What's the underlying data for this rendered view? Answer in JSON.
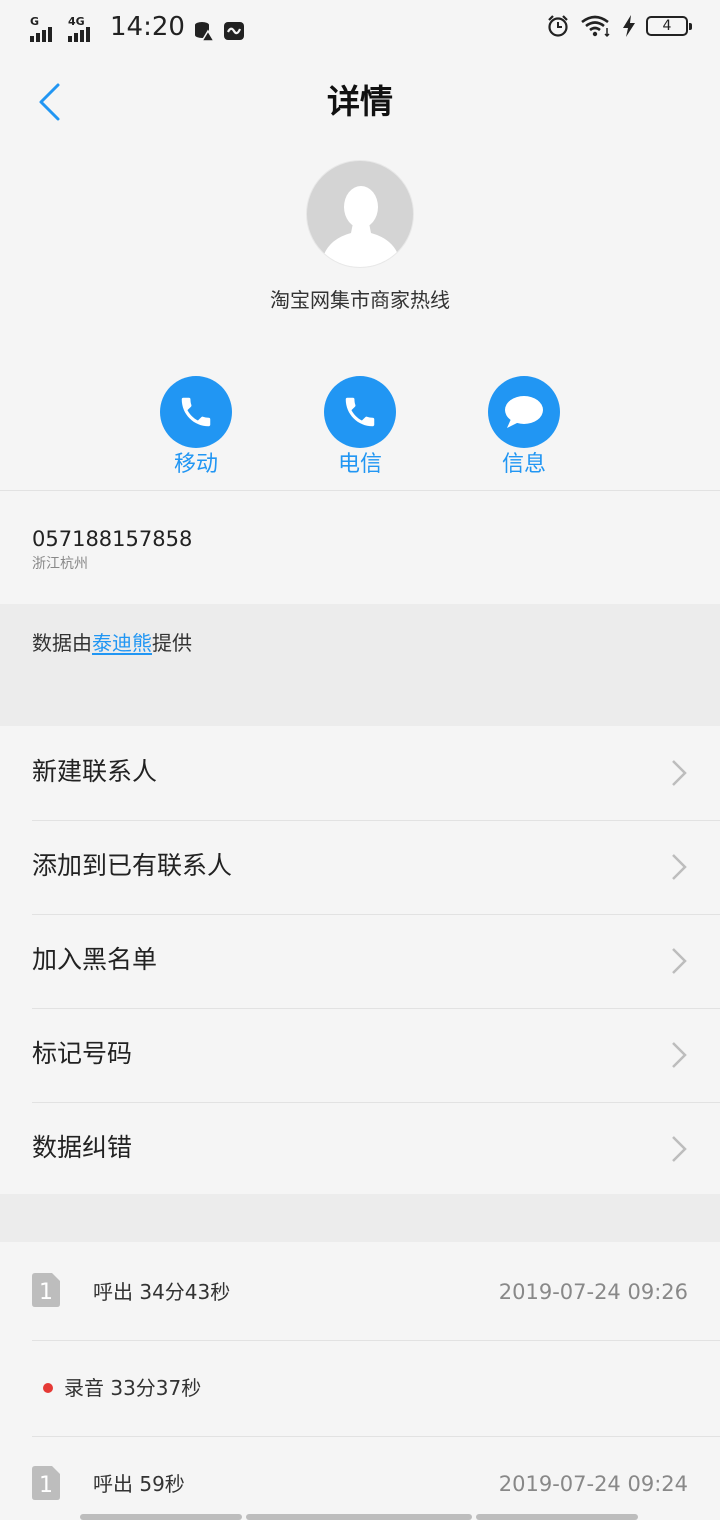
{
  "status_bar": {
    "sim1_tag": "G",
    "sim2_tag": "4G",
    "time": "14:20",
    "battery_level": "4"
  },
  "header": {
    "title": "详情"
  },
  "contact": {
    "name": "淘宝网集市商家热线",
    "phone": "057188157858",
    "location": "浙江杭州"
  },
  "actions": [
    {
      "label": "移动",
      "icon": "phone-icon"
    },
    {
      "label": "电信",
      "icon": "phone-icon"
    },
    {
      "label": "信息",
      "icon": "message-icon"
    }
  ],
  "provider": {
    "prefix": "数据由",
    "link": "泰迪熊",
    "suffix": "提供"
  },
  "menu": [
    {
      "label": "新建联系人"
    },
    {
      "label": "添加到已有联系人"
    },
    {
      "label": "加入黑名单"
    },
    {
      "label": "标记号码"
    },
    {
      "label": "数据纠错"
    }
  ],
  "call_log": [
    {
      "sim": "1",
      "text": "呼出 34分43秒",
      "time": "2019-07-24 09:26"
    },
    {
      "recording": "录音 33分37秒"
    },
    {
      "sim": "1",
      "text": "呼出 59秒",
      "time": "2019-07-24 09:24"
    }
  ],
  "colors": {
    "accent": "#2196f3",
    "recording_dot": "#e53935",
    "background": "#f5f5f5"
  }
}
